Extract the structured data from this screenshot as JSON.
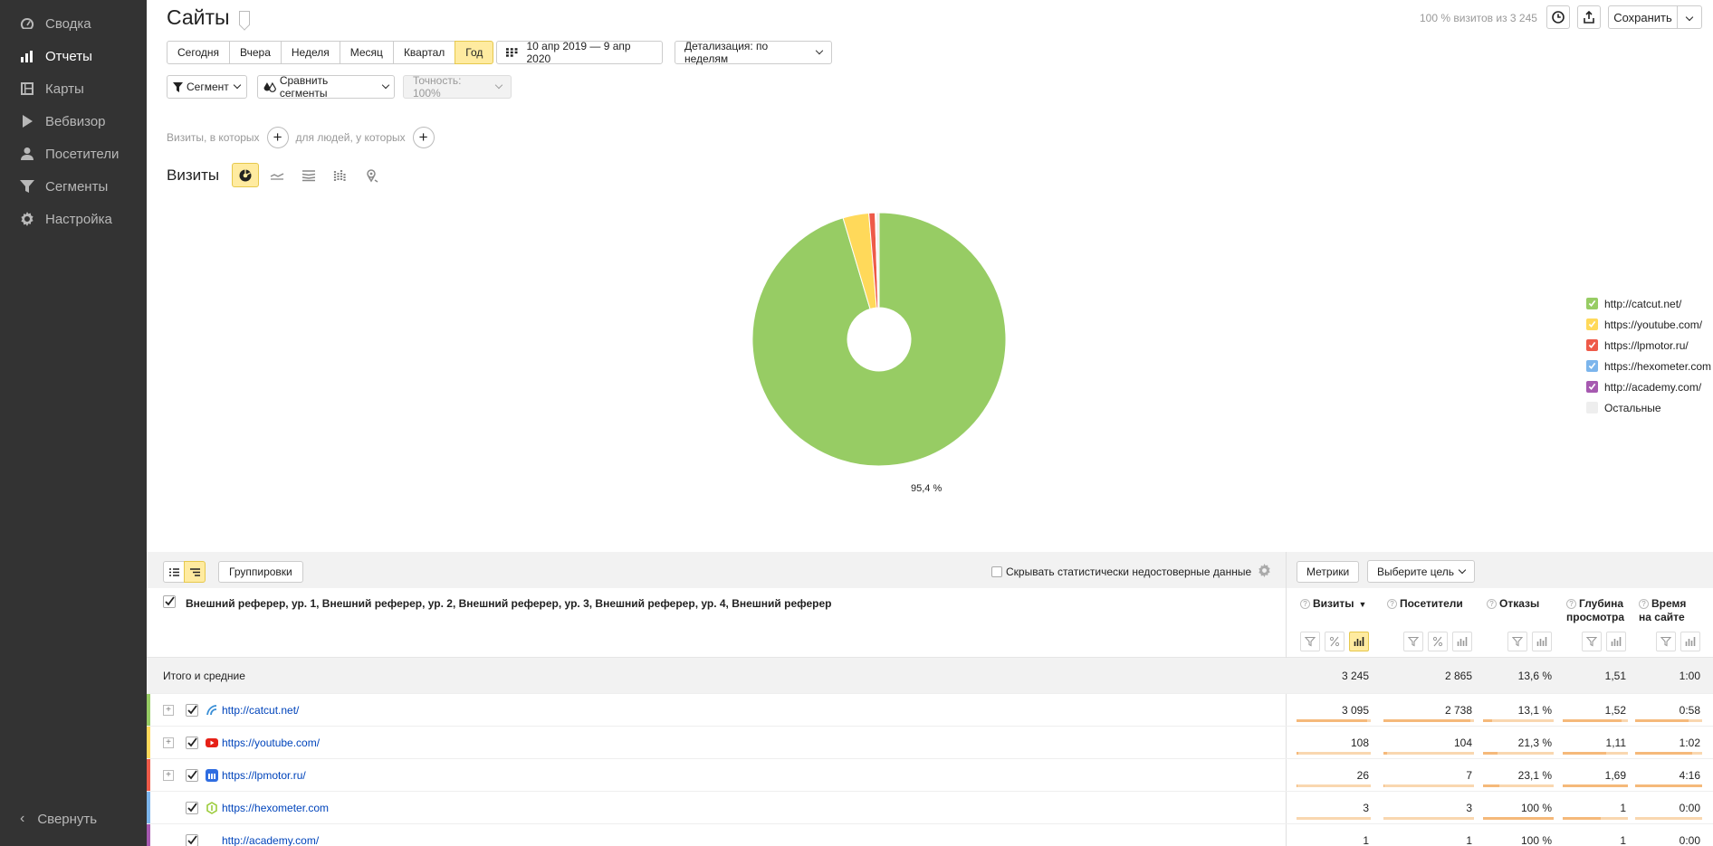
{
  "sidebar": {
    "items": [
      {
        "label": "Сводка",
        "icon": "gauge-icon",
        "active": false
      },
      {
        "label": "Отчеты",
        "icon": "bar-chart-icon",
        "active": true
      },
      {
        "label": "Карты",
        "icon": "map-icon",
        "active": false
      },
      {
        "label": "Вебвизор",
        "icon": "play-icon",
        "active": false
      },
      {
        "label": "Посетители",
        "icon": "person-icon",
        "active": false
      },
      {
        "label": "Сегменты",
        "icon": "funnel-icon",
        "active": false
      },
      {
        "label": "Настройка",
        "icon": "gear-icon",
        "active": false
      }
    ],
    "collapse_label": "Свернуть"
  },
  "header": {
    "title": "Сайты",
    "visits_info": "100 % визитов из 3 245",
    "save_label": "Сохранить"
  },
  "periods": [
    "Сегодня",
    "Вчера",
    "Неделя",
    "Месяц",
    "Квартал",
    "Год"
  ],
  "active_period": "Год",
  "date_range": "10 апр 2019 — 9 апр 2020",
  "detail_label": "Детализация: по неделям",
  "segment_label": "Сегмент",
  "compare_label": "Сравнить сегменты",
  "accuracy_label": "Точность: 100%",
  "filters": {
    "visits_where": "Визиты, в которых",
    "people_where": "для людей, у которых"
  },
  "chart_title": "Визиты",
  "chart_data": {
    "type": "pie",
    "title": "Визиты",
    "labels": [
      "http://catcut.net/",
      "https://youtube.com/",
      "https://lpmotor.ru/",
      "https://hexometer.com",
      "http://academy.com/",
      "Остальные"
    ],
    "values": [
      95.4,
      3.3,
      0.8,
      0.1,
      0.03,
      0.37
    ],
    "colors": [
      "#97cc64",
      "#ffd95a",
      "#ee5a49",
      "#7cb5ec",
      "#a659b0",
      "#eeeeee"
    ],
    "shown_label": "95,4 %",
    "legend_position": "right"
  },
  "table": {
    "groupings_label": "Группировки",
    "hide_label": "Скрывать статистически недостоверные данные",
    "metrics_label": "Метрики",
    "goal_label": "Выберите цель",
    "dimension_title": "Внешний реферер, ур. 1, Внешний реферер, ур. 2, Внешний реферер, ур. 3, Внешний реферер, ур. 4, Внешний реферер",
    "columns": [
      {
        "line1": "Визиты",
        "line2": "",
        "sort": "▼"
      },
      {
        "line1": "Посетители",
        "line2": "",
        "sort": ""
      },
      {
        "line1": "Отказы",
        "line2": "",
        "sort": ""
      },
      {
        "line1": "Глубина",
        "line2": "просмотра",
        "sort": ""
      },
      {
        "line1": "Время",
        "line2": "на сайте",
        "sort": ""
      }
    ],
    "total": {
      "label": "Итого и средние",
      "values": [
        "3 245",
        "2 865",
        "13,6 %",
        "1,51",
        "1:00"
      ]
    },
    "rows": [
      {
        "label": "http://catcut.net/",
        "color": "#97cc64",
        "icon": "catcut-icon",
        "expandable": true,
        "values": [
          "3 095",
          "2 738",
          "13,1 %",
          "1,52",
          "0:58"
        ],
        "fill": [
          0.95,
          0.96,
          0.13,
          0.9,
          0.8
        ]
      },
      {
        "label": "https://youtube.com/",
        "color": "#ffd95a",
        "icon": "youtube-icon",
        "expandable": true,
        "values": [
          "108",
          "104",
          "21,3 %",
          "1,11",
          "1:02"
        ],
        "fill": [
          0.03,
          0.04,
          0.21,
          0.66,
          0.85
        ]
      },
      {
        "label": "https://lpmotor.ru/",
        "color": "#ee5a49",
        "icon": "lpmotor-icon",
        "expandable": true,
        "values": [
          "26",
          "7",
          "23,1 %",
          "1,69",
          "4:16"
        ],
        "fill": [
          0.01,
          0.01,
          0.23,
          1.0,
          1.0
        ]
      },
      {
        "label": "https://hexometer.com",
        "color": "#7cb5ec",
        "icon": "hexometer-icon",
        "expandable": false,
        "values": [
          "3",
          "3",
          "100 %",
          "1",
          "0:00"
        ],
        "fill": [
          0.0,
          0.0,
          1.0,
          0.59,
          0.0
        ]
      },
      {
        "label": "http://academy.com/",
        "color": "#a659b0",
        "icon": "",
        "expandable": false,
        "values": [
          "1",
          "1",
          "100 %",
          "1",
          "0:00"
        ],
        "fill": [
          0.0,
          0.0,
          1.0,
          0.59,
          0.0
        ]
      }
    ]
  }
}
